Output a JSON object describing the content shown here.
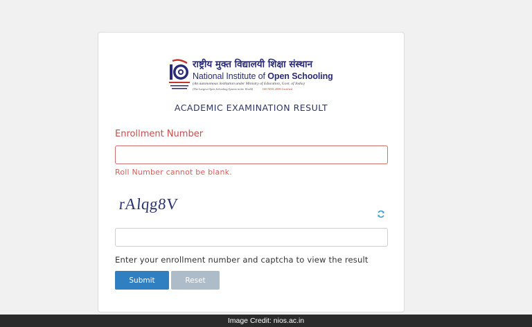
{
  "logo": {
    "hindi": "राष्ट्रीय मुक्त विद्यालयी शिक्षा संस्थान",
    "english_prefix": "National Institute of ",
    "english_bold": "Open Schooling",
    "subtitle": "(An autonomous institution under Ministry of Education, Govt. of India)",
    "tagline": "(The Largest Open Schooling System in the World)",
    "tagline_extra": "ISO 9001:2008 Certified"
  },
  "page_title": "ACADEMIC EXAMINATION RESULT",
  "form": {
    "enrollment_label": "Enrollment Number",
    "enrollment_value": "",
    "error_message": "Roll Number cannot be blank.",
    "captcha_text": "rAlqg8V",
    "captcha_input_value": "",
    "hint": "Enter your enrollment number and captcha to view the result",
    "submit_label": "Submit",
    "reset_label": "Reset"
  },
  "credit": "Image Credit: nios.ac.in",
  "colors": {
    "accent": "#2f7fc1",
    "error": "#c0504d",
    "reset": "#aebbc9",
    "title": "#2d3561"
  }
}
